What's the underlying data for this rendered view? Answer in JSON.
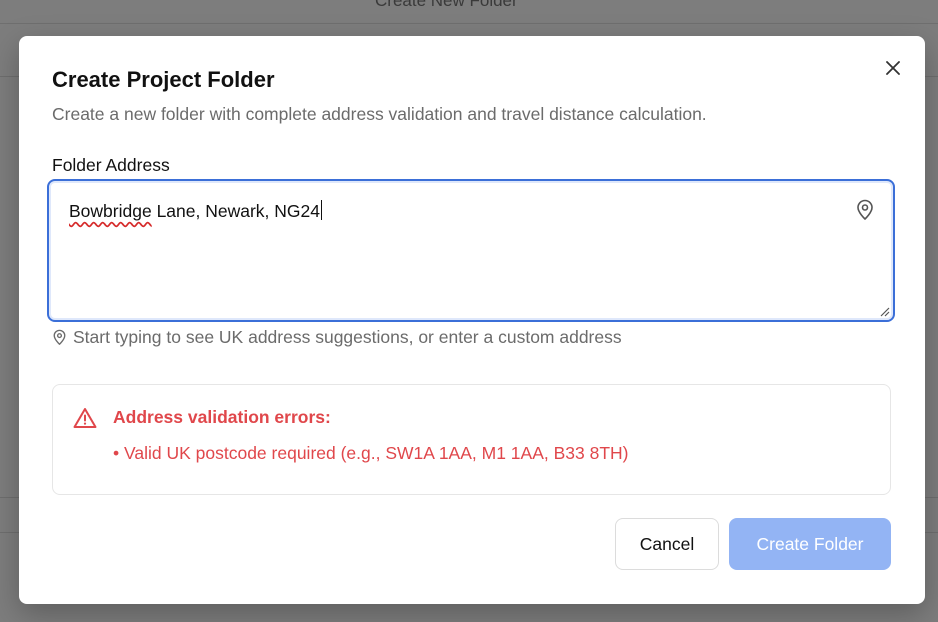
{
  "background": {
    "header_text": "Create New Folder"
  },
  "dialog": {
    "title": "Create Project Folder",
    "subtitle": "Create a new folder with complete address validation and travel distance calculation.",
    "close_icon": "close-icon",
    "address_field": {
      "label": "Folder Address",
      "value_misspelled": "Bowbridge",
      "value_rest": " Lane, Newark, NG24",
      "icon": "map-pin-icon"
    },
    "hint": {
      "icon": "map-pin-icon",
      "text": "Start typing to see UK address suggestions, or enter a custom address"
    },
    "errors": {
      "icon": "warning-triangle-icon",
      "title": "Address validation errors:",
      "items": [
        "• Valid UK postcode required (e.g., SW1A 1AA, M1 1AA, B33 8TH)"
      ]
    },
    "buttons": {
      "cancel": "Cancel",
      "create": "Create Folder"
    },
    "colors": {
      "accent": "#3b6fd8",
      "error": "#e0474b",
      "disabled_primary": "#93b4f4"
    }
  }
}
